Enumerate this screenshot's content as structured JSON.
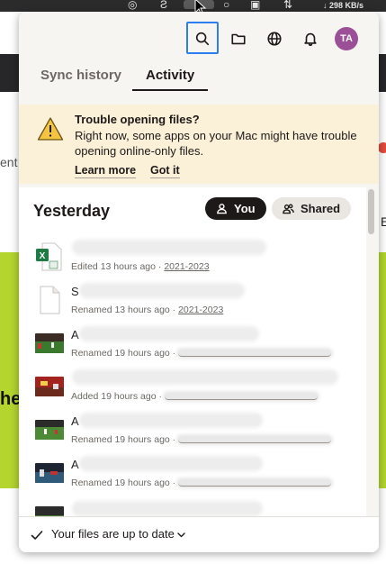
{
  "menubar": {
    "network_speed": "↓ 298 KB/s"
  },
  "background": {
    "left_fragment": "ent",
    "left_fragment_2": "hel",
    "right_fragment": "E"
  },
  "toolbar": {
    "icons": [
      "search-icon",
      "folder-icon",
      "globe-icon",
      "bell-icon"
    ],
    "avatar_initials": "TA",
    "focus_color": "#2d7ff0"
  },
  "tabs": [
    {
      "label": "Sync history",
      "active": false
    },
    {
      "label": "Activity",
      "active": true
    }
  ],
  "banner": {
    "title": "Trouble opening files?",
    "body": "Right now, some apps on your Mac might have trouble opening online-only files.",
    "learn_more": "Learn more",
    "got_it": "Got it",
    "background_color": "#fbf0d8"
  },
  "activity": {
    "section_title": "Yesterday",
    "filter_you": "You",
    "filter_shared": "Shared",
    "items": [
      {
        "thumb": "excel-file-icon",
        "title": "",
        "action": "Edited 13 hours ago · ",
        "folder": "2021-2023"
      },
      {
        "thumb": "blank-file-icon",
        "title": "S",
        "action": "Renamed 13 hours ago · ",
        "folder": "2021-2023"
      },
      {
        "thumb": "video-thumbnail",
        "title": "A",
        "action": "Renamed 19 hours ago · ",
        "folder": ""
      },
      {
        "thumb": "video-thumbnail",
        "title": "",
        "action": "Added 19 hours ago · ",
        "folder": ""
      },
      {
        "thumb": "video-thumbnail",
        "title": "A",
        "action": "Renamed 19 hours ago · ",
        "folder": ""
      },
      {
        "thumb": "video-thumbnail",
        "title": "A",
        "action": "Renamed 19 hours ago · ",
        "folder": ""
      },
      {
        "thumb": "video-thumbnail",
        "title": "",
        "action": "",
        "folder": ""
      }
    ]
  },
  "footer": {
    "status": "Your files are up to date"
  },
  "colors": {
    "avatar": "#9b4f96",
    "brand_green": "#b3d52e",
    "warning": "#f5c542"
  }
}
